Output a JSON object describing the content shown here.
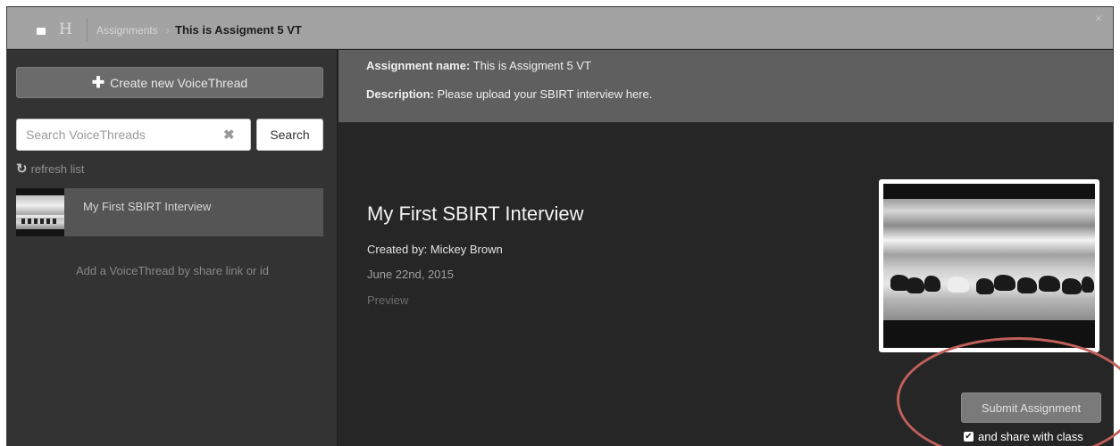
{
  "topbar": {
    "logo_letter": "H",
    "breadcrumb_parent": "Assignments",
    "breadcrumb_separator": "›",
    "breadcrumb_current": "This is Assigment 5 VT",
    "close_symbol": "×"
  },
  "sidebar": {
    "create_button_label": "Create new VoiceThread",
    "search_placeholder": "Search VoiceThreads",
    "search_button_label": "Search",
    "refresh_label": "refresh list",
    "items": [
      {
        "title": "My First SBIRT Interview"
      }
    ],
    "add_link_label": "Add a VoiceThread by share link or id"
  },
  "assignment": {
    "name_label": "Assignment name:",
    "name_value": "This is Assigment 5 VT",
    "description_label": "Description:",
    "description_value": "Please upload your SBIRT interview here."
  },
  "voicethread": {
    "title": "My First SBIRT Interview",
    "created_by": "Created by: Mickey Brown",
    "date": "June 22nd, 2015",
    "preview_label": "Preview"
  },
  "submit": {
    "button_label": "Submit Assignment",
    "share_label": "and share with class",
    "share_checked": true
  },
  "icons": {
    "plus": "plus-icon",
    "clear": "clear-icon",
    "refresh": "refresh-icon",
    "checkbox": "checkbox-icon"
  },
  "colors": {
    "topbar": "#a3a3a3",
    "sidebar": "#333333",
    "content": "#262626",
    "assignment_bar": "#5f5f5f",
    "annotation_circle": "#c0605a"
  }
}
